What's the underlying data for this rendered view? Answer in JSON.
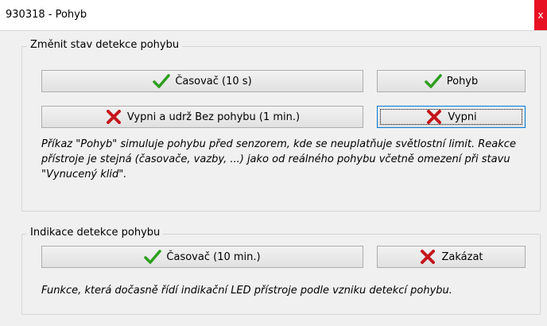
{
  "window": {
    "title": "930318 - Pohyb",
    "close_label": "x"
  },
  "motion_group": {
    "title": "Změnit stav detekce pohybu",
    "buttons": {
      "timer": "Časovač (10 s)",
      "motion": "Pohyb",
      "off_hold": "Vypni a udrž Bez pohybu (1 min.)",
      "off": "Vypni"
    },
    "note": "Příkaz \"Pohyb\" simuluje pohybu před senzorem, kde se neuplatňuje světlostní limit. Reakce přístroje je stejná (časovače, vazby, ...) jako od reálného pohybu včetně omezení při stavu \"Vynucený klid\"."
  },
  "indication_group": {
    "title": "Indikace detekce pohybu",
    "buttons": {
      "timer": "Časovač (10 min.)",
      "disable": "Zakázat"
    },
    "note": "Funkce, která dočasně řídí indikační LED přístroje podle vzniku detekcí pohybu."
  },
  "colors": {
    "check": "#2e9e1f",
    "cross": "#c4161c",
    "close": "#e81123",
    "focus": "#0078d7"
  },
  "icons": {
    "check": "check-icon",
    "cross": "cross-icon"
  }
}
